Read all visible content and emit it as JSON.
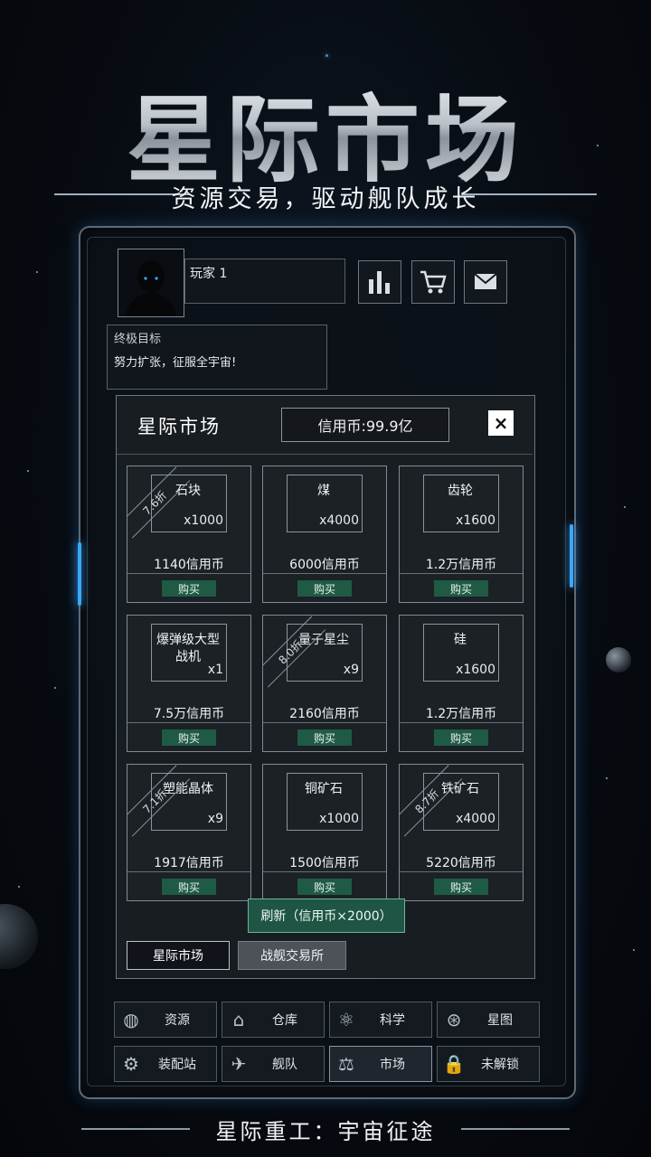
{
  "headline": "星际市场",
  "tagline": "资源交易，驱动舰队成长",
  "player": {
    "name": "玩家 1"
  },
  "goal": {
    "title": "终极目标",
    "text": "努力扩张，征服全宇宙!"
  },
  "market": {
    "title": "星际市场",
    "credits": "信用币:99.9亿",
    "close_label": "×",
    "buy_label": "购买",
    "items": [
      {
        "name": "石块",
        "qty": "x1000",
        "price": "1140信用币",
        "discount": "7.6折"
      },
      {
        "name": "煤",
        "qty": "x4000",
        "price": "6000信用币",
        "discount": ""
      },
      {
        "name": "齿轮",
        "qty": "x1600",
        "price": "1.2万信用币",
        "discount": ""
      },
      {
        "name": "爆弹级大型战机",
        "qty": "x1",
        "price": "7.5万信用币",
        "discount": ""
      },
      {
        "name": "量子星尘",
        "qty": "x9",
        "price": "2160信用币",
        "discount": "8.0折"
      },
      {
        "name": "硅",
        "qty": "x1600",
        "price": "1.2万信用币",
        "discount": ""
      },
      {
        "name": "塑能晶体",
        "qty": "x9",
        "price": "1917信用币",
        "discount": "7.1折"
      },
      {
        "name": "铜矿石",
        "qty": "x1000",
        "price": "1500信用币",
        "discount": ""
      },
      {
        "name": "铁矿石",
        "qty": "x4000",
        "price": "5220信用币",
        "discount": "8.7折"
      }
    ],
    "refresh_label": "刷新（信用币×2000）",
    "tabs": [
      "星际市场",
      "战舰交易所"
    ]
  },
  "nav": [
    {
      "label": "资源",
      "icon": "planet-icon"
    },
    {
      "label": "仓库",
      "icon": "warehouse-icon"
    },
    {
      "label": "科学",
      "icon": "atom-icon"
    },
    {
      "label": "星图",
      "icon": "star-map-icon"
    },
    {
      "label": "装配站",
      "icon": "gear-icon"
    },
    {
      "label": "舰队",
      "icon": "fleet-icon"
    },
    {
      "label": "市场",
      "icon": "scale-icon"
    },
    {
      "label": "未解锁",
      "icon": "lock-icon"
    }
  ],
  "footer": "星际重工：宇宙征途",
  "colors": {
    "accent_blue": "#3aa8ff",
    "buy_green": "#1f5a45",
    "panel": "#181d22"
  }
}
